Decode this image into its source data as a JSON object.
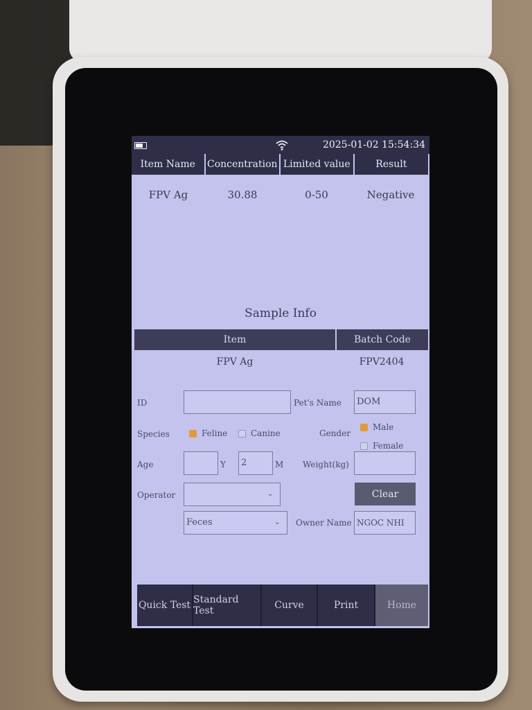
{
  "status": {
    "datetime": "2025-01-02 15:54:34",
    "battery_icon": "battery-icon",
    "wifi_icon": "wifi-icon"
  },
  "results": {
    "headers": [
      "Item Name",
      "Concentration",
      "Limited value",
      "Result"
    ],
    "rows": [
      [
        "FPV Ag",
        "30.88",
        "0-50",
        "Negative"
      ]
    ]
  },
  "sample_info": {
    "title": "Sample Info",
    "headers": [
      "Item",
      "Batch Code"
    ],
    "row": [
      "FPV Ag",
      "FPV2404"
    ],
    "fields": {
      "id_label": "ID",
      "id_value": "",
      "pet_name_label": "Pet's Name",
      "pet_name_value": "DOM",
      "species_label": "Species",
      "species_options": [
        "Feline",
        "Canine"
      ],
      "species_selected": "Feline",
      "gender_label": "Gender",
      "gender_options": [
        "Male",
        "Female"
      ],
      "gender_selected": "Male",
      "age_label": "Age",
      "age_years": "",
      "age_years_unit": "Y",
      "age_months": "2",
      "age_months_unit": "M",
      "weight_label": "Weight(kg)",
      "weight_value": "",
      "operator_label": "Operator",
      "operator_value": "",
      "sample_type_value": "Feces",
      "owner_name_label": "Owner Name",
      "owner_name_value": "NGOC NHI",
      "clear_label": "Clear"
    }
  },
  "nav": [
    "Quick Test",
    "Standard Test",
    "Curve",
    "Print",
    "Home"
  ],
  "colors": {
    "screen_bg": "#c3c3ee",
    "header_bg": "#2e2e48",
    "checked": "#e39a3c"
  }
}
